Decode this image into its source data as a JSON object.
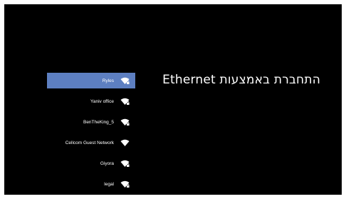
{
  "screen": {
    "title": "התחברת באמצעות Ethernet"
  },
  "networks": [
    {
      "name": "Ryles",
      "icon": "wifi-locked-icon",
      "selected": true
    },
    {
      "name": "Yaniv office",
      "icon": "wifi-locked-icon",
      "selected": false
    },
    {
      "name": "BenTheKing_5",
      "icon": "wifi-locked-icon",
      "selected": false
    },
    {
      "name": "Cellcom Guest Network",
      "icon": "wifi-icon",
      "selected": false
    },
    {
      "name": "Giyora",
      "icon": "wifi-locked-icon",
      "selected": false
    },
    {
      "name": "legal",
      "icon": "wifi-locked-icon",
      "selected": false
    }
  ],
  "colors": {
    "background": "#000000",
    "selected": "#5d7fc1",
    "text": "#ffffff"
  }
}
